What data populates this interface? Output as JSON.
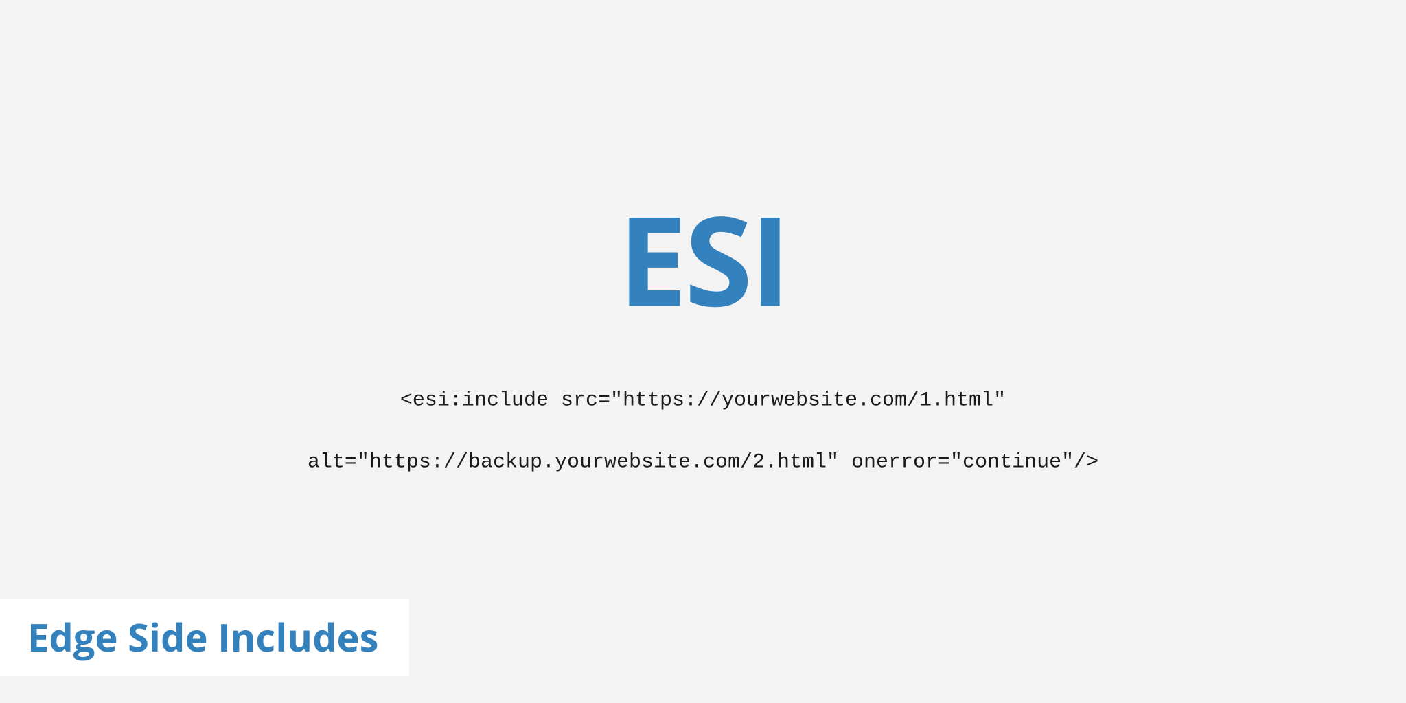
{
  "main": {
    "title": "ESI",
    "code_line1": "<esi:include src=\"https://yourwebsite.com/1.html\"",
    "code_line2": "alt=\"https://backup.yourwebsite.com/2.html\" onerror=\"continue\"/>"
  },
  "footer": {
    "label": "Edge Side Includes"
  }
}
